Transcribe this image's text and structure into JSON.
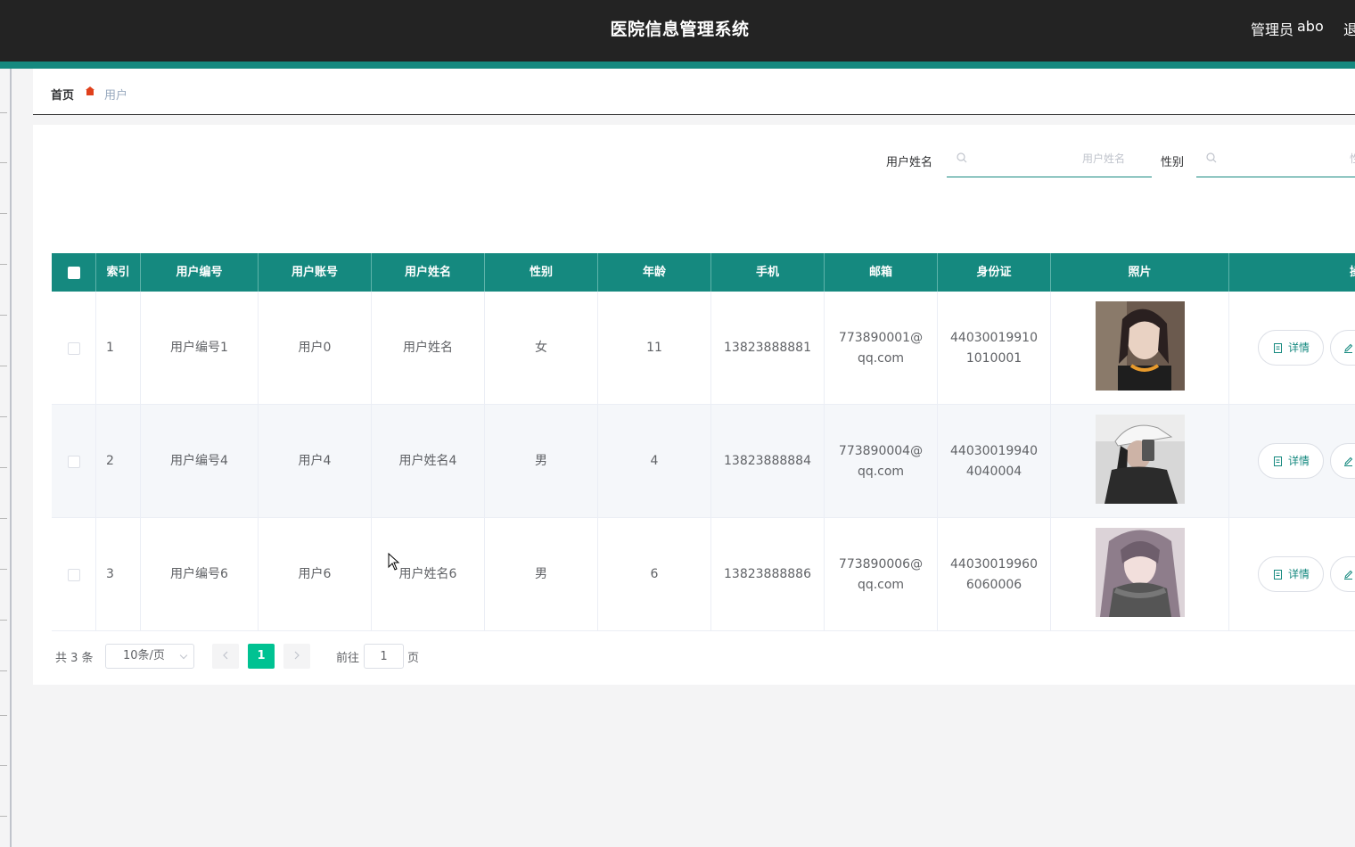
{
  "header": {
    "title": "医院信息管理系统",
    "admin_role": "管理员",
    "admin_name": "abo",
    "logout": "退出"
  },
  "breadcrumb": {
    "home": "首页",
    "current": "用户"
  },
  "search": {
    "name_label": "用户姓名",
    "name_placeholder": "用户姓名",
    "gender_label": "性别",
    "gender_placeholder": "性别"
  },
  "table": {
    "columns": [
      "索引",
      "用户编号",
      "用户账号",
      "用户姓名",
      "性别",
      "年龄",
      "手机",
      "邮箱",
      "身份证",
      "照片",
      "操作"
    ],
    "detail_label": "详情",
    "rows": [
      {
        "index": "1",
        "user_no": "用户编号1",
        "account": "用户0",
        "name": "用户姓名",
        "gender": "女",
        "age": "11",
        "phone": "13823888881",
        "email": "773890001@qq.com",
        "id_card": "440300199101010001",
        "photo": "photo-young-woman-dark-hair"
      },
      {
        "index": "2",
        "user_no": "用户编号4",
        "account": "用户4",
        "name": "用户姓名4",
        "gender": "男",
        "age": "4",
        "phone": "13823888884",
        "email": "773890004@qq.com",
        "id_card": "440300199404040004",
        "photo": "photo-person-white-cap-selfie"
      },
      {
        "index": "3",
        "user_no": "用户编号6",
        "account": "用户6",
        "name": "用户姓名6",
        "gender": "男",
        "age": "6",
        "phone": "13823888886",
        "email": "773890006@qq.com",
        "id_card": "440300199606060006",
        "photo": "photo-woman-grey-scarf"
      }
    ]
  },
  "pagination": {
    "total": "共 3 条",
    "page_size": "10条/页",
    "current_page": "1",
    "goto_label": "前往",
    "goto_value": "1",
    "page_suffix": "页"
  },
  "colors": {
    "accent": "#15897f",
    "header_bg": "#232323",
    "active_page": "#00c292"
  }
}
